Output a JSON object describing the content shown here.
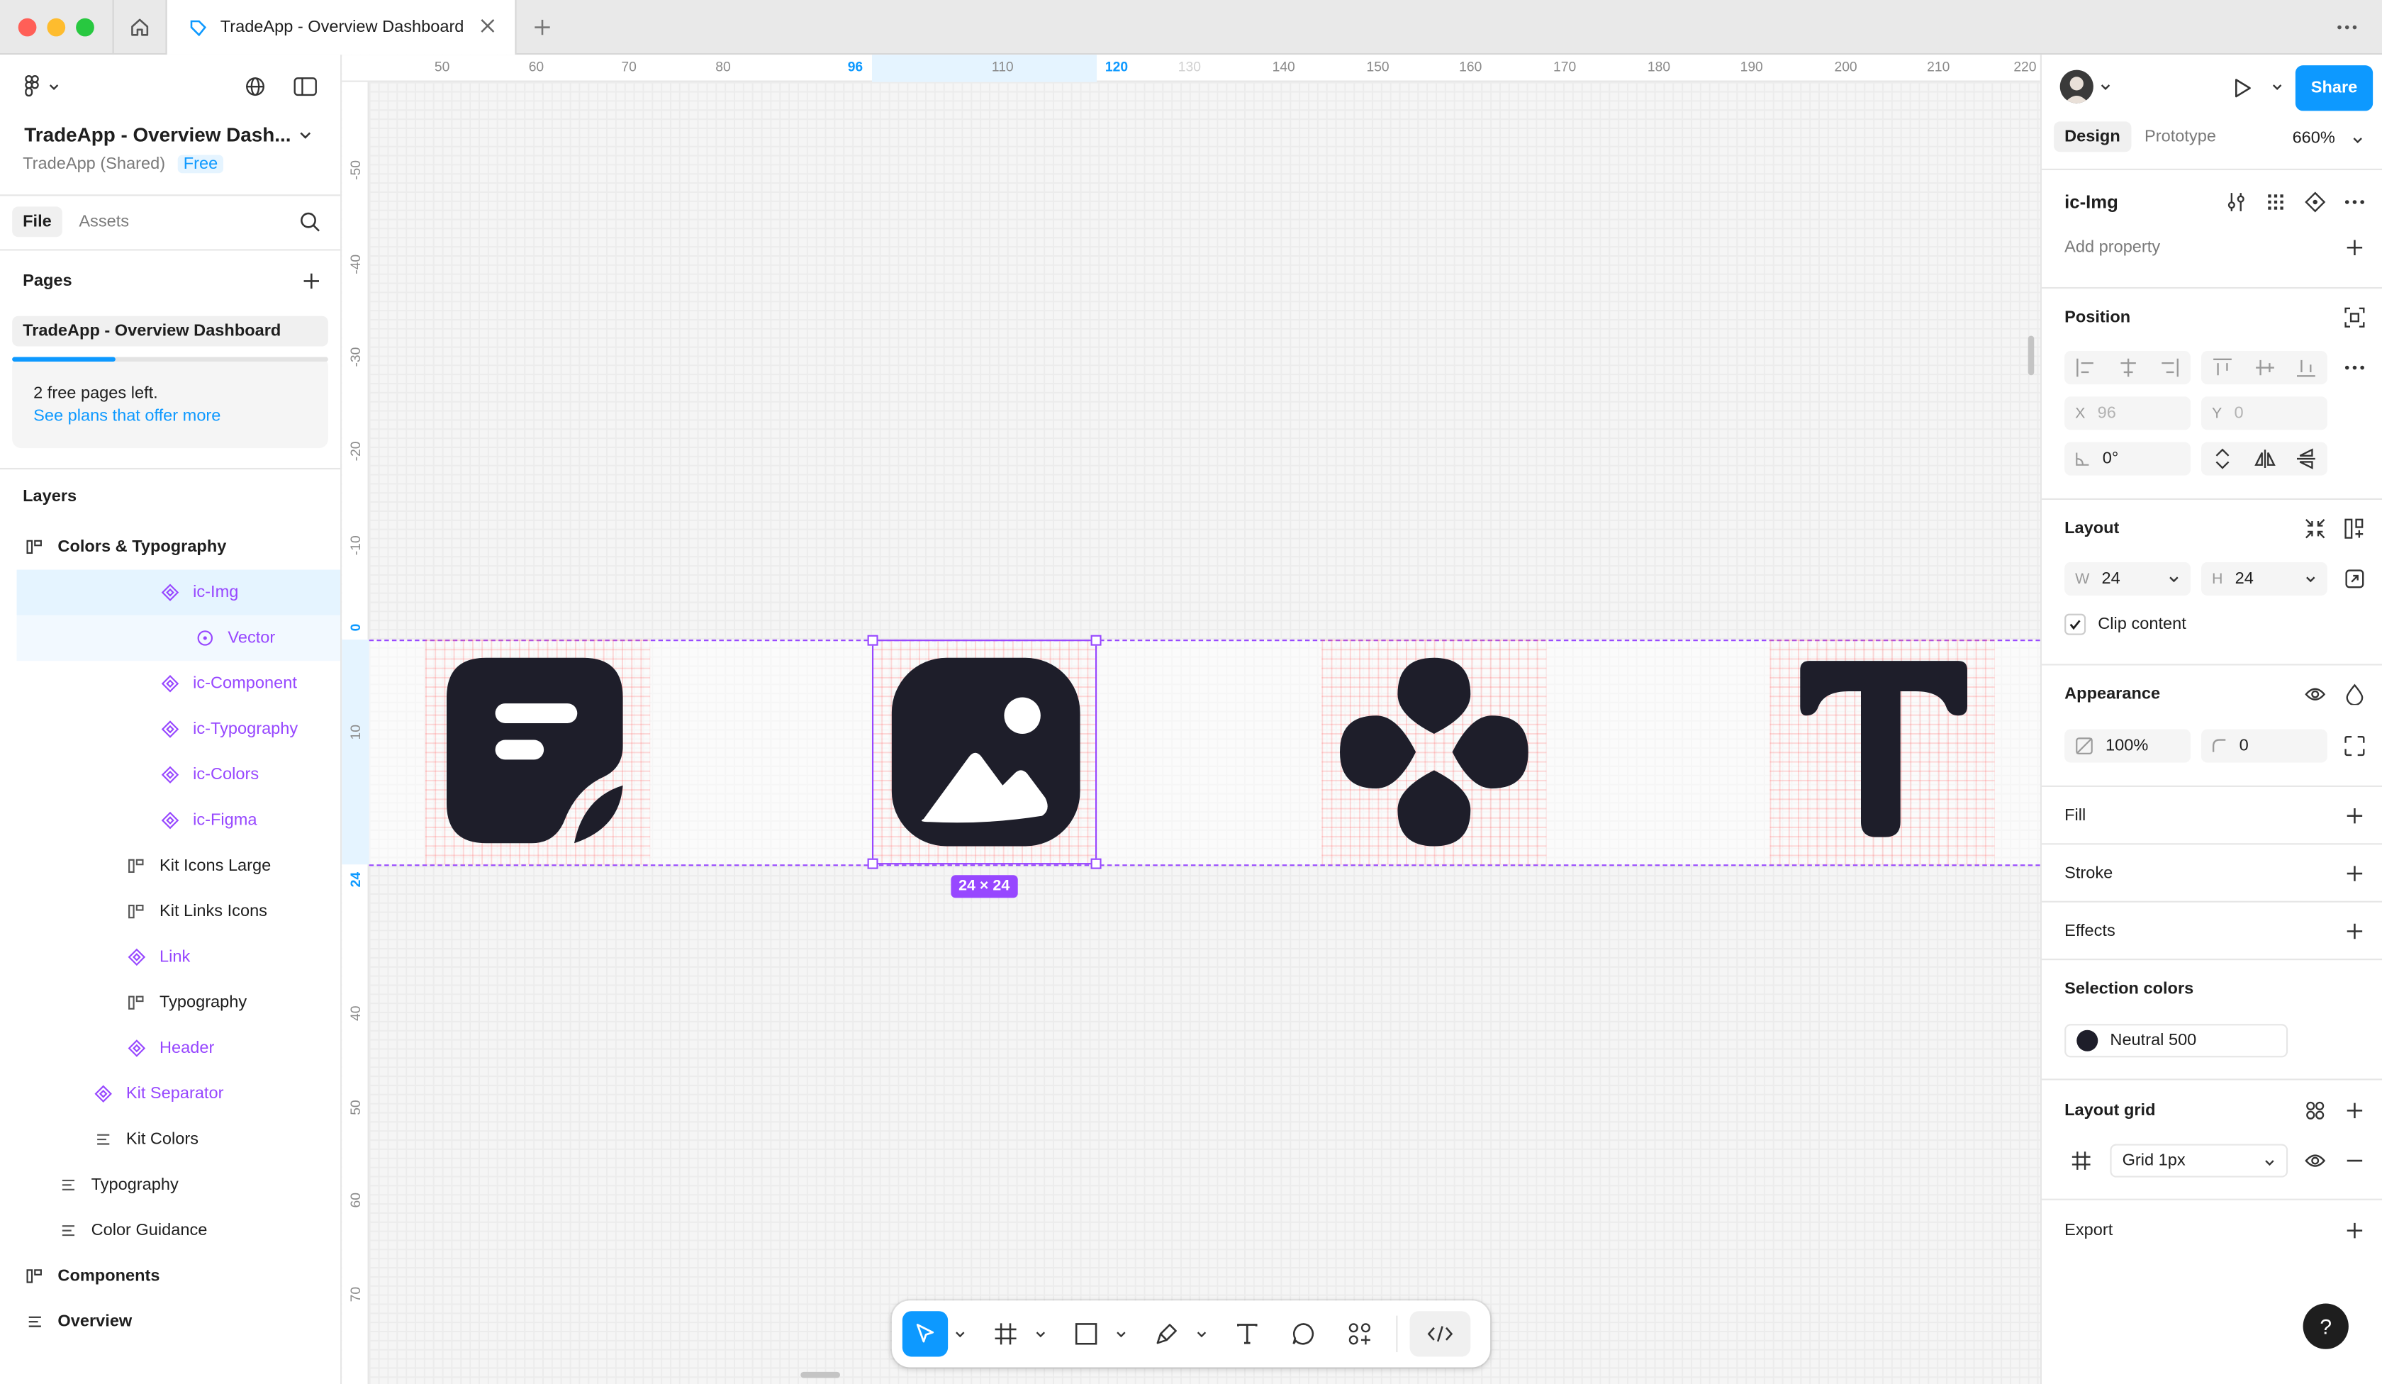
{
  "browser": {
    "tab_title": "TradeApp - Overview Dashboard"
  },
  "file": {
    "title": "TradeApp - Overview Dash...",
    "team": "TradeApp (Shared)",
    "plan_badge": "Free",
    "tabs": [
      "File",
      "Assets"
    ]
  },
  "pages": {
    "title": "Pages",
    "current": "TradeApp - Overview Dashboard",
    "plan_notice": "2 free pages left.",
    "plan_link": "See plans that offer more"
  },
  "layers": {
    "title": "Layers",
    "items": [
      {
        "label": "Colors & Typography"
      },
      {
        "label": "ic-Img"
      },
      {
        "label": "Vector"
      },
      {
        "label": "ic-Component"
      },
      {
        "label": "ic-Typography"
      },
      {
        "label": "ic-Colors"
      },
      {
        "label": "ic-Figma"
      },
      {
        "label": "Kit Icons Large"
      },
      {
        "label": "Kit Links Icons"
      },
      {
        "label": "Link"
      },
      {
        "label": "Typography"
      },
      {
        "label": "Header"
      },
      {
        "label": "Kit Separator"
      },
      {
        "label": "Kit Colors"
      },
      {
        "label": "Typography"
      },
      {
        "label": "Color Guidance"
      },
      {
        "label": "Components"
      },
      {
        "label": "Overview"
      }
    ]
  },
  "canvas": {
    "ruler_h": [
      "50",
      "60",
      "70",
      "80",
      "96",
      "110",
      "120",
      "130",
      "140",
      "150",
      "160",
      "170",
      "180",
      "190",
      "200",
      "210",
      "220"
    ],
    "ruler_v": [
      "-50",
      "-40",
      "-30",
      "-20",
      "-10",
      "0",
      "10",
      "24",
      "40",
      "50",
      "60",
      "70"
    ],
    "selection_size": "24 × 24"
  },
  "design_panel": {
    "share_label": "Share",
    "tabs": [
      "Design",
      "Prototype"
    ],
    "zoom": "660%",
    "component_name": "ic-Img",
    "add_property": "Add property",
    "position": {
      "title": "Position",
      "x_label": "X",
      "x_value": "96",
      "y_label": "Y",
      "y_value": "0",
      "rotation": "0°"
    },
    "layout": {
      "title": "Layout",
      "w_label": "W",
      "w_value": "24",
      "h_label": "H",
      "h_value": "24",
      "clip_content": "Clip content"
    },
    "appearance": {
      "title": "Appearance",
      "opacity": "100%",
      "radius": "0"
    },
    "fill": "Fill",
    "stroke": "Stroke",
    "effects": "Effects",
    "selection_colors": {
      "title": "Selection colors",
      "color_name": "Neutral 500",
      "color_hex": "#1e1e2a"
    },
    "layout_grid": {
      "title": "Layout grid",
      "grid": "Grid 1px"
    },
    "export": "Export",
    "help": "?"
  },
  "colors": {
    "accent": "#0d99ff",
    "component": "#9747ff",
    "icon_fill": "#1e1e2a"
  }
}
